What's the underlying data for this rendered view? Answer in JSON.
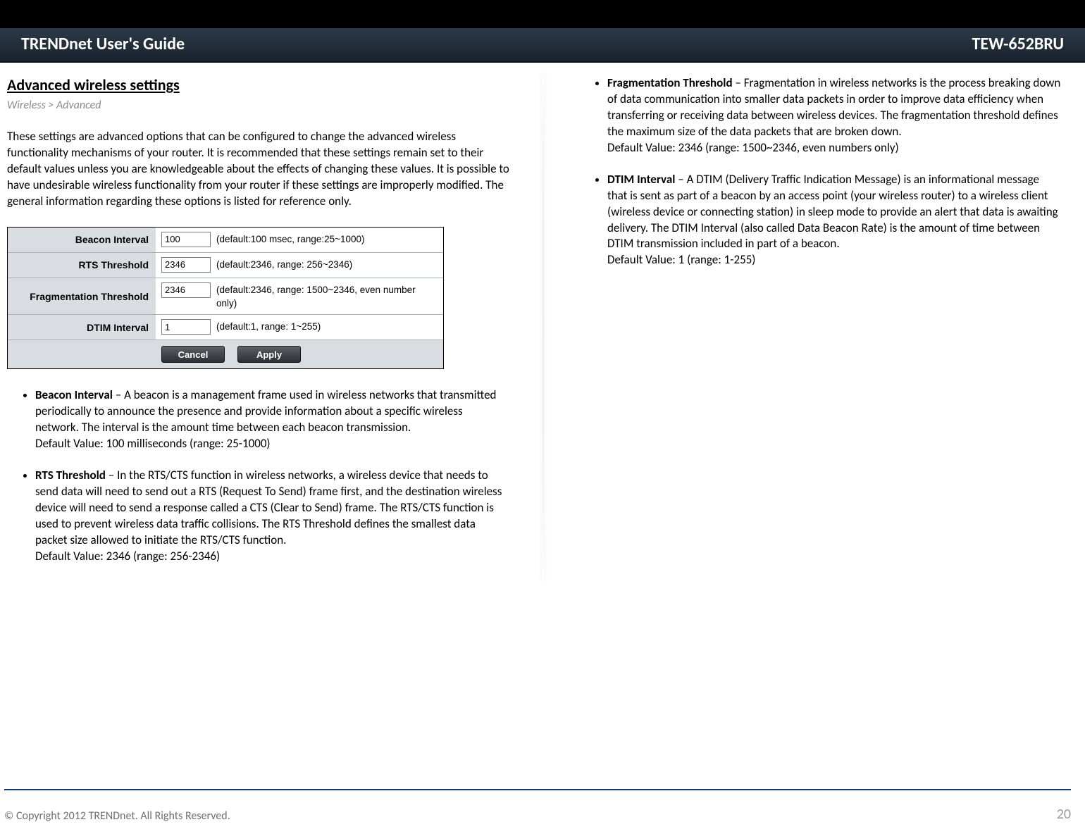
{
  "header": {
    "left": "TRENDnet User's Guide",
    "right": "TEW-652BRU"
  },
  "section": {
    "title": "Advanced wireless settings",
    "breadcrumb": "Wireless > Advanced"
  },
  "intro": "These settings are advanced options that can be configured to change the advanced wireless functionality mechanisms of your router. It is recommended that these settings remain set to their default values unless you are knowledgeable about the effects of changing these values. It is possible to have undesirable wireless functionality from your router if these settings are improperly modified. The general information regarding these options is listed for reference only.",
  "form": {
    "rows": [
      {
        "label": "Beacon Interval",
        "value": "100",
        "hint": "(default:100 msec, range:25~1000)"
      },
      {
        "label": "RTS Threshold",
        "value": "2346",
        "hint": "(default:2346, range: 256~2346)"
      },
      {
        "label": "Fragmentation Threshold",
        "value": "2346",
        "hint": "(default:2346, range: 1500~2346, even number only)"
      },
      {
        "label": "DTIM Interval",
        "value": "1",
        "hint": "(default:1, range: 1~255)"
      }
    ],
    "buttons": {
      "cancel": "Cancel",
      "apply": "Apply"
    }
  },
  "bullets_left": [
    {
      "term": "Beacon Interval",
      "text": " – A beacon is a management frame used in wireless networks that transmitted periodically to announce the presence and provide information about a specific wireless network. The interval is the amount time between each beacon transmission.",
      "default": "Default Value: 100 milliseconds (range: 25-1000)"
    },
    {
      "term": "RTS Threshold",
      "text": " – In the RTS/CTS function in wireless networks, a wireless device that needs to send data will need to send out a RTS (Request To Send) frame first, and the destination wireless device will need to send a response called a CTS (Clear to Send) frame. The RTS/CTS function is used to prevent wireless data traffic collisions. The RTS Threshold defines the smallest data packet size allowed to initiate the RTS/CTS function.",
      "default": "Default Value: 2346 (range: 256-2346)"
    }
  ],
  "bullets_right": [
    {
      "term": "Fragmentation Threshold",
      "text": " – Fragmentation in wireless networks is the process breaking down of data communication into smaller data packets in order to improve data efficiency when transferring or receiving data between wireless devices. The fragmentation threshold defines the maximum size of the data packets that are broken down.",
      "default": "Default Value: 2346 (range: 1500~2346, even numbers only)"
    },
    {
      "term": "DTIM Interval",
      "text": " – A DTIM (Delivery Traffic Indication Message) is an informational message that is sent as part of a beacon by an access point (your wireless router) to a wireless client (wireless device or connecting station) in sleep mode to provide an alert that data is awaiting delivery. The DTIM Interval (also called Data Beacon Rate) is the amount of time between DTIM transmission included in part of a beacon.",
      "default": "Default Value: 1 (range: 1-255)"
    }
  ],
  "footer": {
    "copyright": "© Copyright 2012 TRENDnet. All Rights Reserved.",
    "page": "20"
  }
}
